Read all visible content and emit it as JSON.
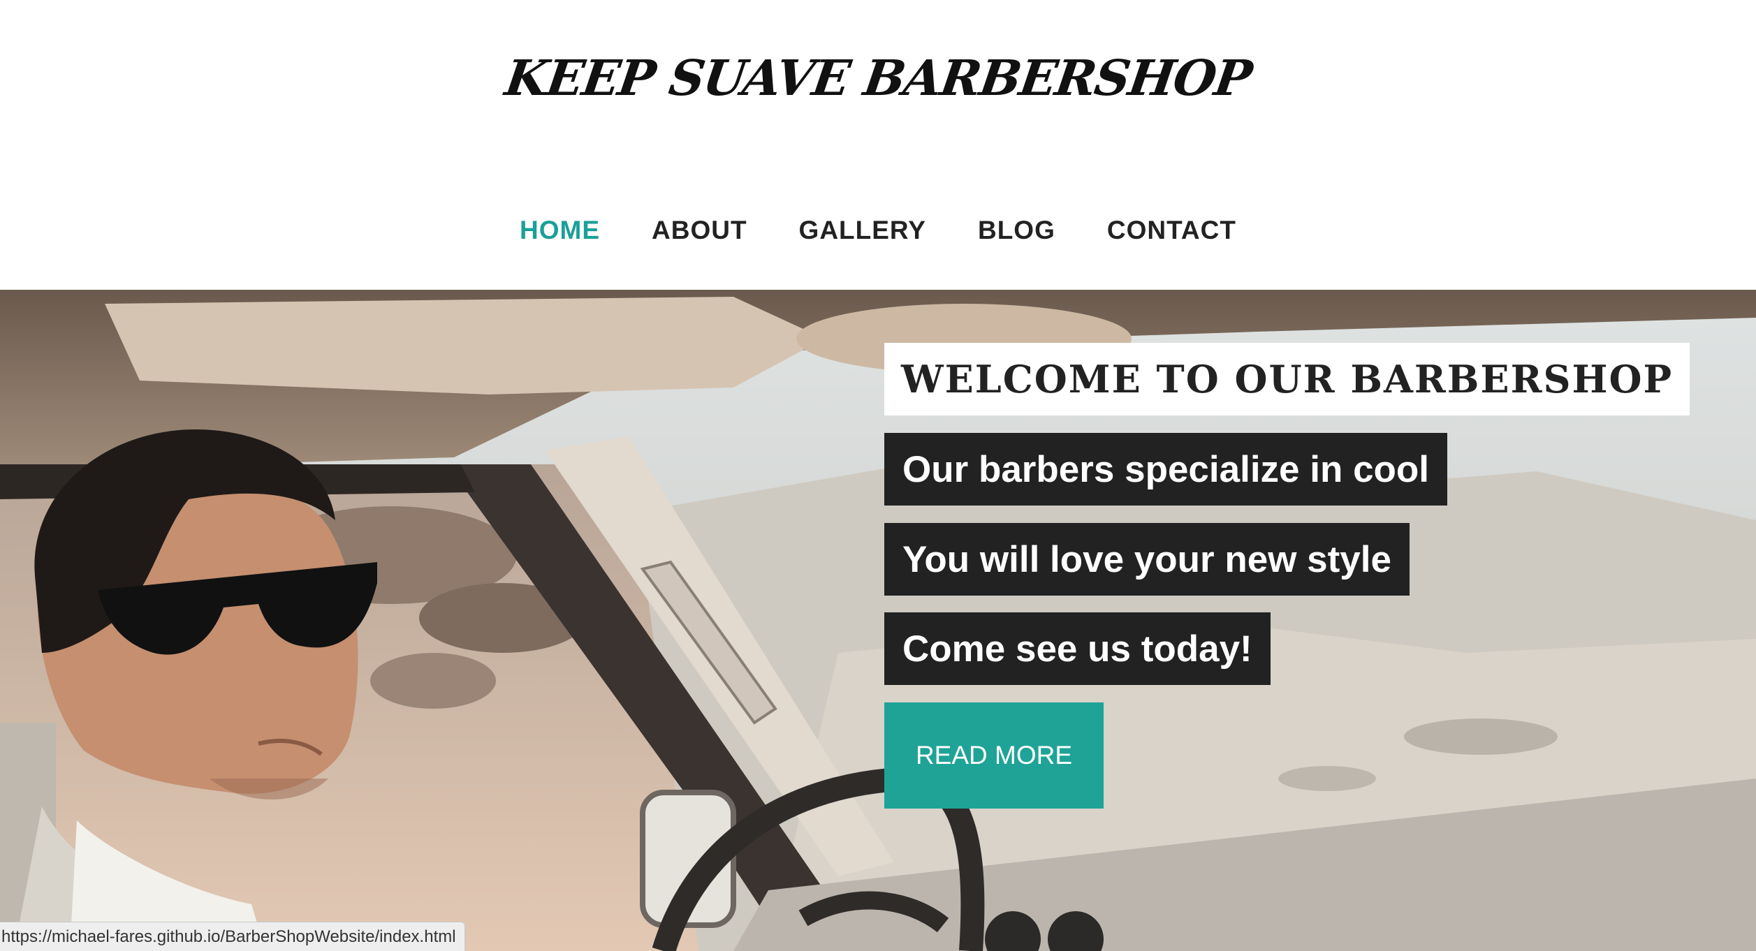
{
  "header": {
    "title": "KEEP SUAVE BARBERSHOP"
  },
  "nav": {
    "items": [
      {
        "label": "HOME",
        "active": true
      },
      {
        "label": "ABOUT",
        "active": false
      },
      {
        "label": "GALLERY",
        "active": false
      },
      {
        "label": "BLOG",
        "active": false
      },
      {
        "label": "CONTACT",
        "active": false
      }
    ]
  },
  "hero": {
    "heading": "WELCOME TO OUR BARBERSHOP",
    "lines": [
      "Our barbers specialize in cool",
      "You will love your new style",
      "Come see us today!"
    ],
    "button_label": "READ MORE",
    "image_alt_icon": "photo-man-driving-car"
  },
  "status_bar": {
    "url": "https://michael-fares.github.io/BarberShopWebsite/index.html"
  },
  "colors": {
    "accent": "#1aa097",
    "text_dark": "#222222",
    "button": "#1fa397"
  }
}
